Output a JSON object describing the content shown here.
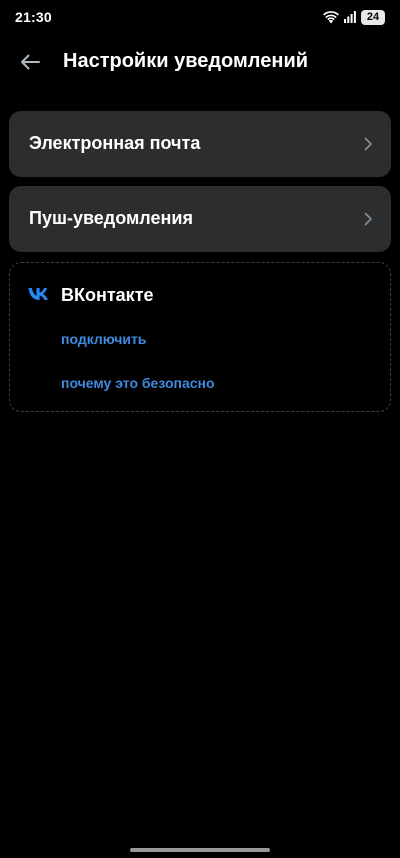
{
  "status_bar": {
    "time": "21:30",
    "battery": "24",
    "icons": [
      "wifi-icon",
      "signal-icon",
      "battery-icon"
    ]
  },
  "header": {
    "back_icon": "arrow-left-icon",
    "title": "Настройки уведомлений"
  },
  "settings": {
    "items": [
      {
        "label": "Электронная почта",
        "icon": "chevron-right-icon"
      },
      {
        "label": "Пуш-уведомления",
        "icon": "chevron-right-icon"
      }
    ]
  },
  "vk": {
    "logo_icon": "vk-logo-icon",
    "title": "ВКонтакте",
    "connect_label": "подключить",
    "why_safe_label": "почему это безопасно"
  },
  "colors": {
    "background": "#000000",
    "card": "#2c2d2e",
    "text": "#ffffff",
    "link": "#3f8ae0",
    "vk_logo": "#2787f5",
    "dashed_border": "#3a3f48"
  }
}
